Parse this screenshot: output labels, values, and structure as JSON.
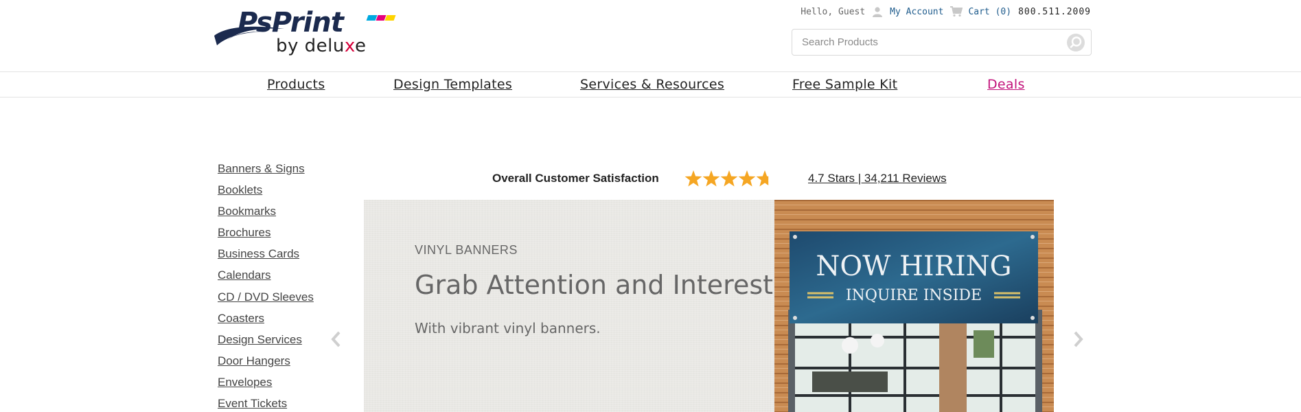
{
  "brand": {
    "logo_word": "PsPrint",
    "logo_by": "by delu",
    "logo_x": "x",
    "logo_e": "e",
    "colors": {
      "navy": "#1b2a4e",
      "cyan": "#00a9e0",
      "magenta": "#e6007e",
      "yellow": "#ffd400",
      "accent_red": "#d6003a"
    }
  },
  "utility": {
    "greeting": "Hello, Guest",
    "account_label": "My Account",
    "account_icon": "user-icon",
    "cart_label": "Cart (0)",
    "cart_icon": "cart-icon",
    "phone": "800.511.2009"
  },
  "search": {
    "placeholder": "Search Products",
    "value": "",
    "icon": "search-icon"
  },
  "nav": {
    "items": [
      {
        "label": "Products"
      },
      {
        "label": "Design Templates"
      },
      {
        "label": "Services & Resources"
      },
      {
        "label": "Free Sample Kit"
      },
      {
        "label": "Deals"
      }
    ],
    "deals_color": "#c2127a"
  },
  "sidebar": {
    "categories": [
      "Banners & Signs",
      "Booklets",
      "Bookmarks",
      "Brochures",
      "Business Cards",
      "Calendars",
      "CD / DVD Sleeves",
      "Coasters",
      "Design Services",
      "Door Hangers",
      "Envelopes",
      "Event Tickets"
    ]
  },
  "rating": {
    "label": "Overall Customer Satisfaction",
    "stars": 4.7,
    "max_stars": 5,
    "summary": "4.7 Stars | 34,211 Reviews",
    "star_color": "#f5a623"
  },
  "hero": {
    "eyebrow": "VINYL BANNERS",
    "headline": "Grab Attention and Interest",
    "subline": "With vibrant vinyl banners.",
    "banner_line1": "NOW HIRING",
    "banner_line2": "INQUIRE INSIDE",
    "prev_icon": "chevron-left-icon",
    "next_icon": "chevron-right-icon"
  }
}
